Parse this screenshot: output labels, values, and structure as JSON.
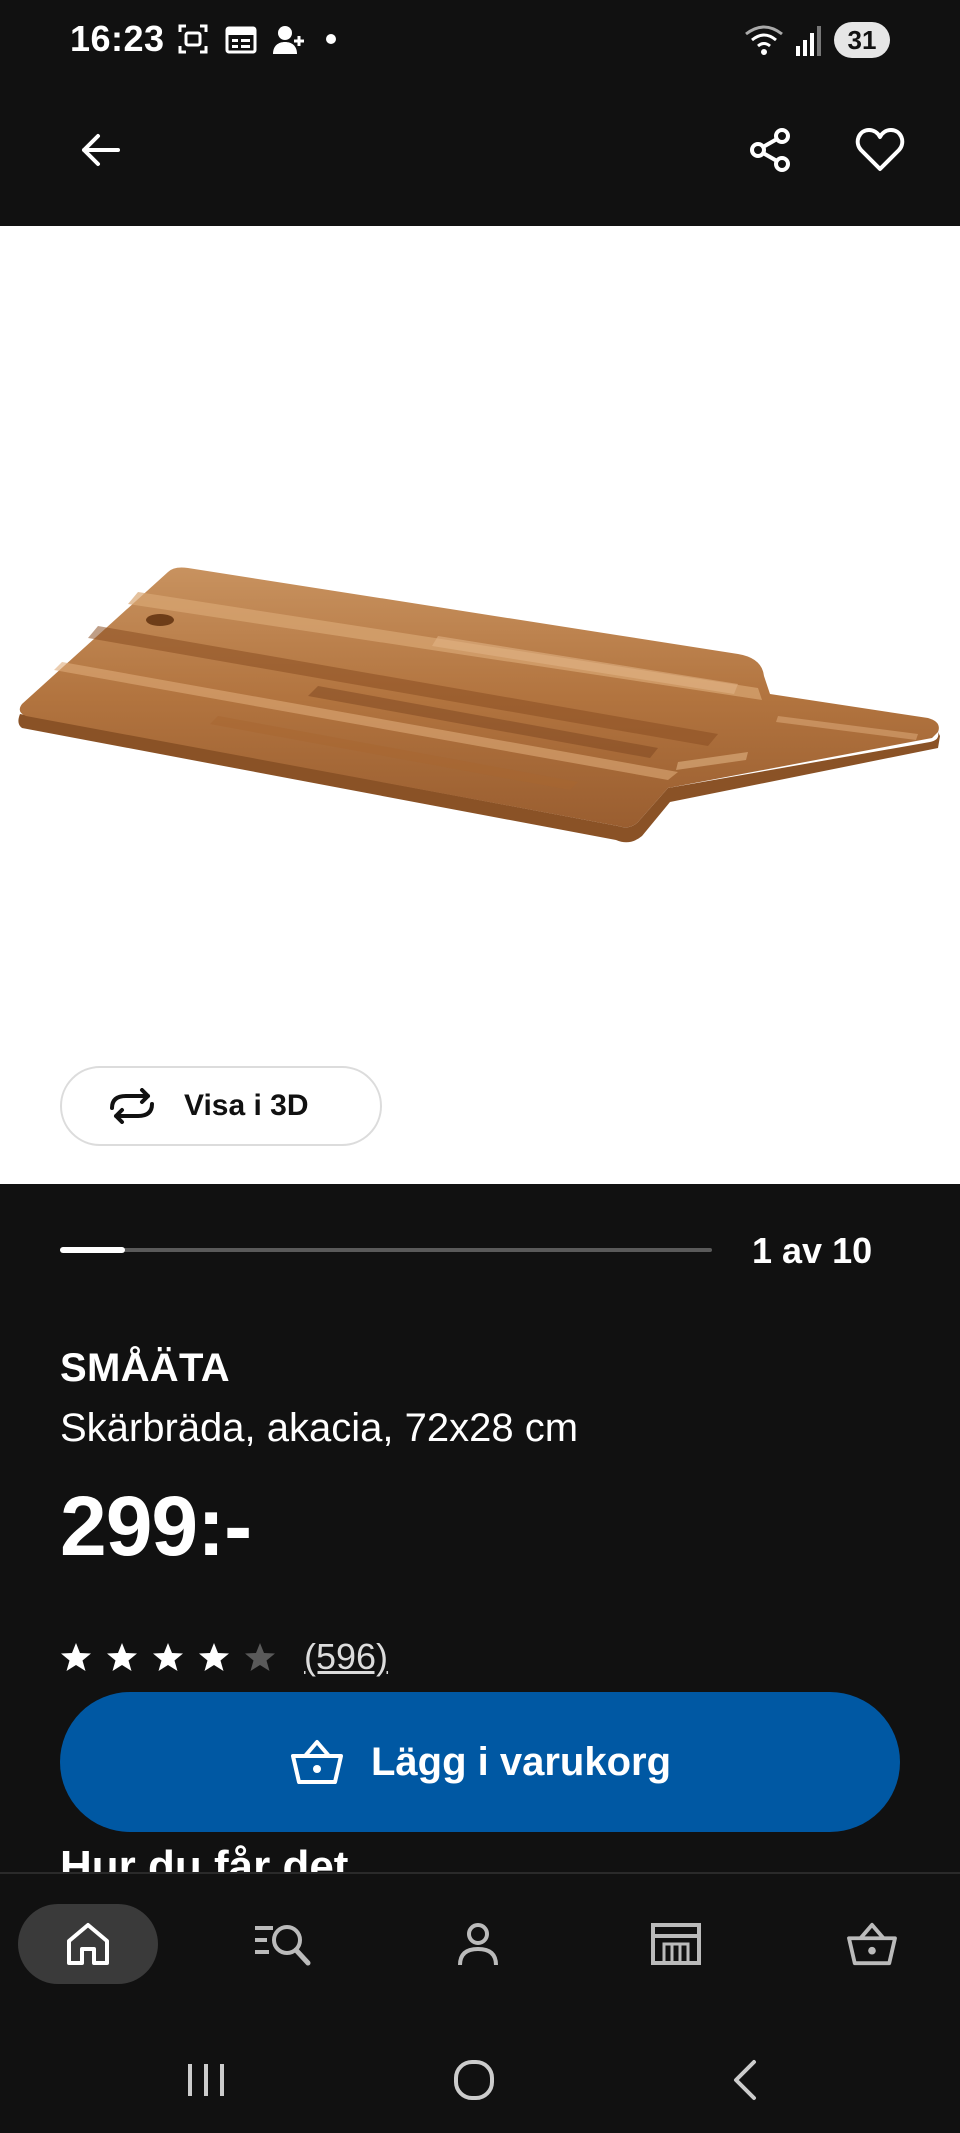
{
  "status_bar": {
    "time": "16:23",
    "battery": "31",
    "icons": [
      "screenshot-icon",
      "calendar-icon",
      "add-contact-icon",
      "notification-dot",
      "wifi-icon",
      "signal-icon"
    ]
  },
  "header": {
    "icons": [
      "back-arrow-icon",
      "share-icon",
      "heart-icon"
    ]
  },
  "gallery": {
    "view_3d_label": "Visa i 3D",
    "counter": "1 av 10",
    "current": 1,
    "total": 10
  },
  "product": {
    "name": "SMÅÄTA",
    "description": "Skärbräda, akacia, 72x28 cm",
    "price": "299:-",
    "rating": 4,
    "rating_max": 5,
    "review_count": "(596)"
  },
  "actions": {
    "add_to_cart_label": "Lägg i varukorg"
  },
  "section": {
    "heading": "Hur du får det"
  },
  "bottom_nav": {
    "items": [
      "home-icon",
      "search-icon",
      "profile-icon",
      "store-icon",
      "basket-icon"
    ],
    "active": "home-icon"
  },
  "colors": {
    "background": "#111111",
    "accent_blue": "#0058a3",
    "image_bg": "#ffffff",
    "star_filled": "#ffffff",
    "star_empty": "#5a5a5a"
  }
}
